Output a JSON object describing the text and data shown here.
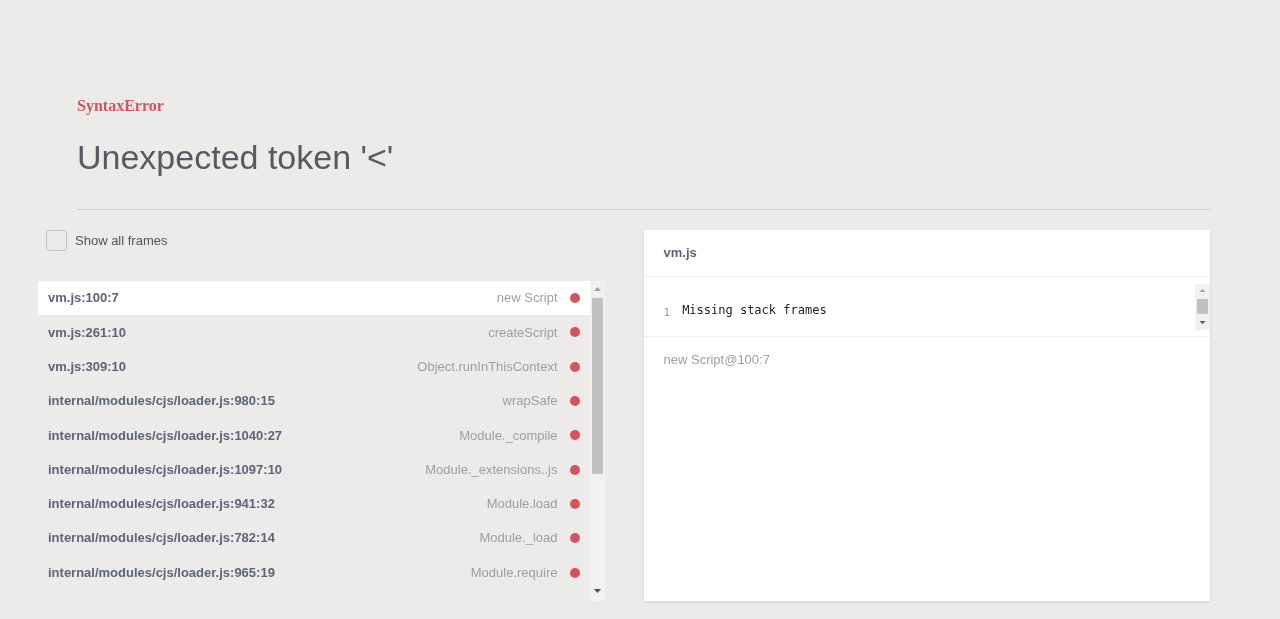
{
  "error": {
    "type": "SyntaxError",
    "message": "Unexpected token '<'"
  },
  "show_all_frames": {
    "label": "Show all frames",
    "checked": false
  },
  "frames": [
    {
      "location": "vm.js:100:7",
      "function": "new Script",
      "selected": true
    },
    {
      "location": "vm.js:261:10",
      "function": "createScript",
      "selected": false
    },
    {
      "location": "vm.js:309:10",
      "function": "Object.runInThisContext",
      "selected": false
    },
    {
      "location": "internal/modules/cjs/loader.js:980:15",
      "function": "wrapSafe",
      "selected": false
    },
    {
      "location": "internal/modules/cjs/loader.js:1040:27",
      "function": "Module._compile",
      "selected": false
    },
    {
      "location": "internal/modules/cjs/loader.js:1097:10",
      "function": "Module._extensions..js",
      "selected": false
    },
    {
      "location": "internal/modules/cjs/loader.js:941:32",
      "function": "Module.load",
      "selected": false
    },
    {
      "location": "internal/modules/cjs/loader.js:782:14",
      "function": "Module._load",
      "selected": false
    },
    {
      "location": "internal/modules/cjs/loader.js:965:19",
      "function": "Module.require",
      "selected": false
    }
  ],
  "source_panel": {
    "file": "vm.js",
    "lines": [
      {
        "number": "1",
        "code": "Missing stack frames"
      }
    ],
    "footer": "new Script@100:7"
  }
}
